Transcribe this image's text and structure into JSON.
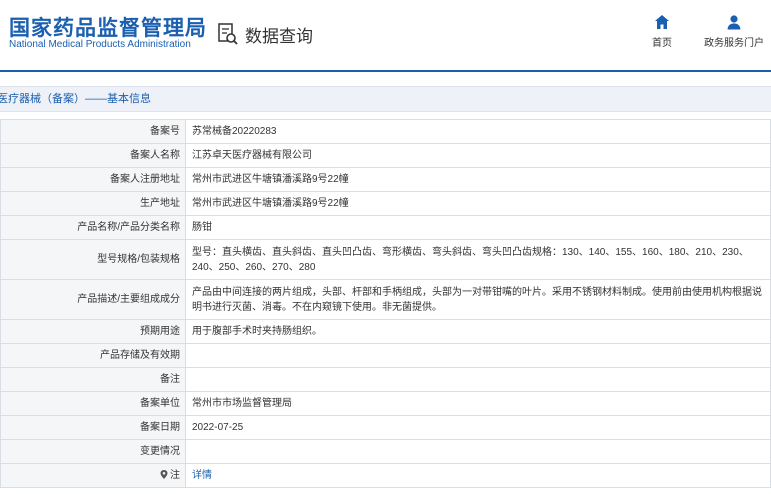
{
  "header": {
    "logo_cn": "国家药品监督管理局",
    "logo_en": "National Medical Products Administration",
    "section": "数据查询",
    "nav": [
      {
        "label": "首页",
        "icon": "home-icon"
      },
      {
        "label": "政务服务门户",
        "icon": "user-icon"
      }
    ]
  },
  "breadcrumb": "医疗器械（备案）——基本信息",
  "colors": {
    "brand": "#1a5fb0",
    "label_bg": "#f5f6f8",
    "border": "#d9dde4"
  },
  "rows": [
    {
      "label": "备案号",
      "value": "苏常械备20220283"
    },
    {
      "label": "备案人名称",
      "value": "江苏卓天医疗器械有限公司"
    },
    {
      "label": "备案人注册地址",
      "value": "常州市武进区牛塘镇潘溪路9号22幢"
    },
    {
      "label": "生产地址",
      "value": "常州市武进区牛塘镇潘溪路9号22幢"
    },
    {
      "label": "产品名称/产品分类名称",
      "value": "肠钳"
    },
    {
      "label": "型号规格/包装规格",
      "value": "型号：直头横齿、直头斜齿、直头凹凸齿、弯形横齿、弯头斜齿、弯头凹凸齿规格：130、140、155、160、180、210、230、240、250、260、270、280"
    },
    {
      "label": "产品描述/主要组成成分",
      "value": "产品由中间连接的两片组成，头部、杆部和手柄组成，头部为一对带钳嘴的叶片。采用不锈钢材料制成。使用前由使用机构根据说明书进行灭菌、消毒。不在内窥镜下使用。非无菌提供。"
    },
    {
      "label": "预期用途",
      "value": "用于腹部手术时夹持肠组织。"
    },
    {
      "label": "产品存储及有效期",
      "value": ""
    },
    {
      "label": "备注",
      "value": ""
    },
    {
      "label": "备案单位",
      "value": "常州市市场监督管理局"
    },
    {
      "label": "备案日期",
      "value": "2022-07-25"
    },
    {
      "label": "变更情况",
      "value": ""
    },
    {
      "label": "注",
      "value": "详情",
      "icon": "pin-icon"
    }
  ]
}
